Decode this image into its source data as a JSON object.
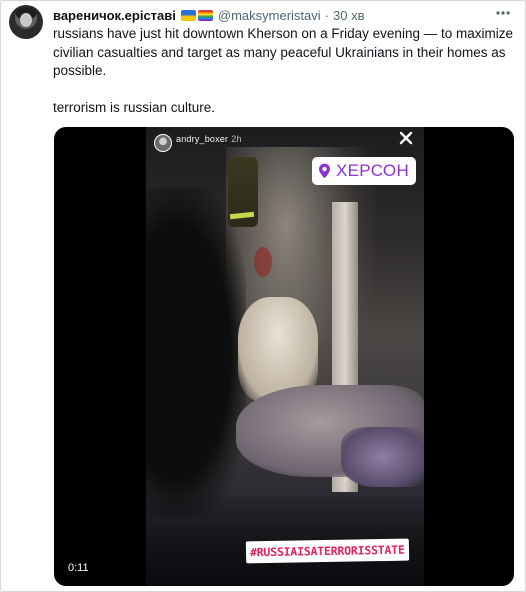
{
  "tweet": {
    "display_name": "вареничок.еріставі",
    "handle": "@maksymeristavi",
    "separator": "·",
    "time": "30 хв",
    "more_icon": "more-horizontal-icon",
    "text_paragraph_1": "russians have just hit downtown Kherson on a Friday evening — to maximize civilian casualties and target as many peaceful Ukrainians in their homes as possible.",
    "text_paragraph_2": "terrorism is russian culture."
  },
  "media": {
    "story_username": "andry_boxer",
    "story_age": "2h",
    "close_icon": "close-icon",
    "location_sticker": "ХЕРСОН",
    "location_icon": "map-pin-icon",
    "location_color": "#8a34d6",
    "hashtag_sticker": "#RUSSIAISATERRORISSTATE",
    "hashtag_color": "#e0245e",
    "duration": "0:11"
  }
}
